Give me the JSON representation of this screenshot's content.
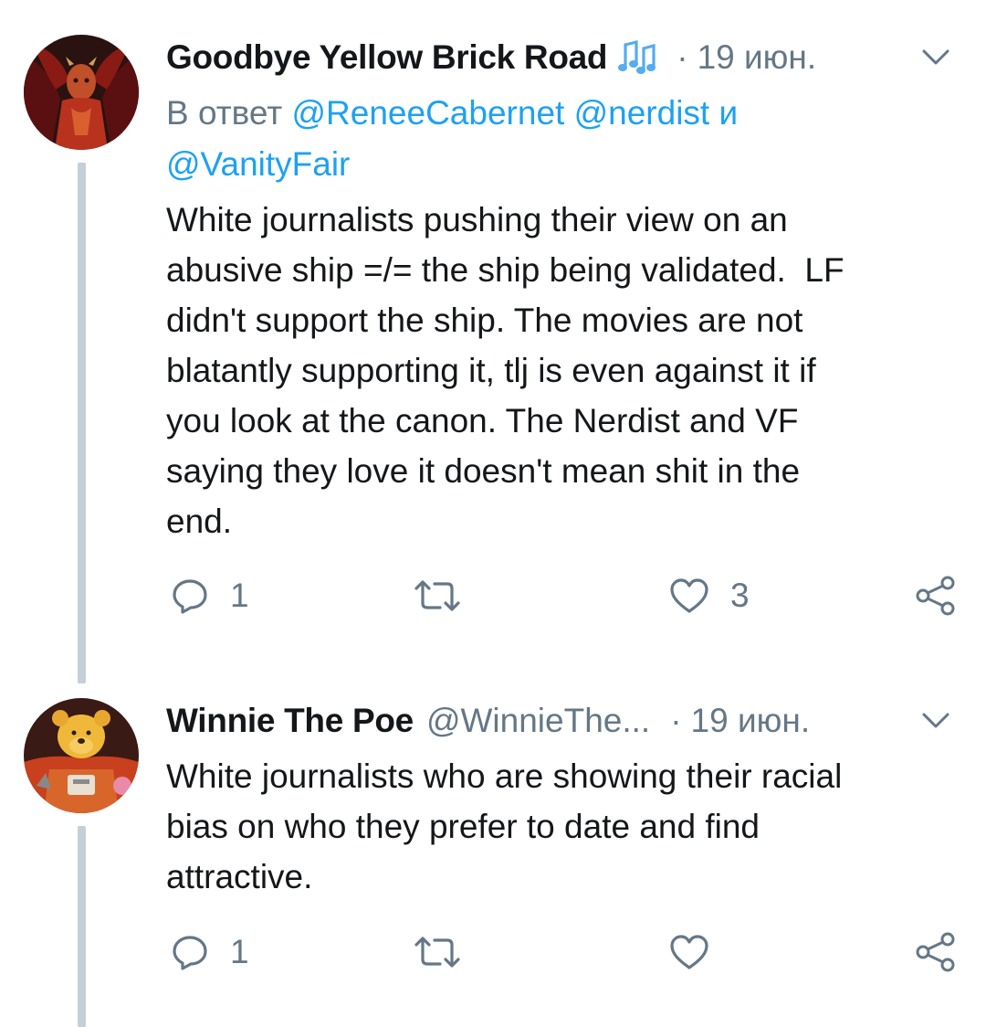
{
  "tweets": [
    {
      "display_name": "Goodbye Yellow Brick Road",
      "name_icon": "music-notes-icon",
      "separator": "·",
      "date": "19 июн.",
      "reply_prefix": "В ответ",
      "reply_mention_1": "@ReneeCabernet",
      "reply_mention_2": "@nerdist",
      "reply_conjunction": "и",
      "reply_mention_3": "@VanityFair",
      "text": "White journalists pushing their view on an\nabusive ship =/= the ship being validated.  LF\ndidn't support the ship. The movies are not\nblatantly supporting it, tlj is even against it if\nyou look at the canon. The Nerdist and VF\nsaying they love it doesn't mean shit in the\nend.",
      "reply_count": "1",
      "like_count": "3"
    },
    {
      "display_name": "Winnie The Poe",
      "handle": "@WinnieThe...",
      "separator": "·",
      "date": "19 июн.",
      "text": "White journalists who are showing their racial\nbias on who they prefer to date and find\nattractive.",
      "reply_count": "1"
    }
  ],
  "colors": {
    "text_primary": "#14171a",
    "text_secondary": "#657786",
    "link": "#1da1f2",
    "thread_line": "#c4cfd6"
  }
}
